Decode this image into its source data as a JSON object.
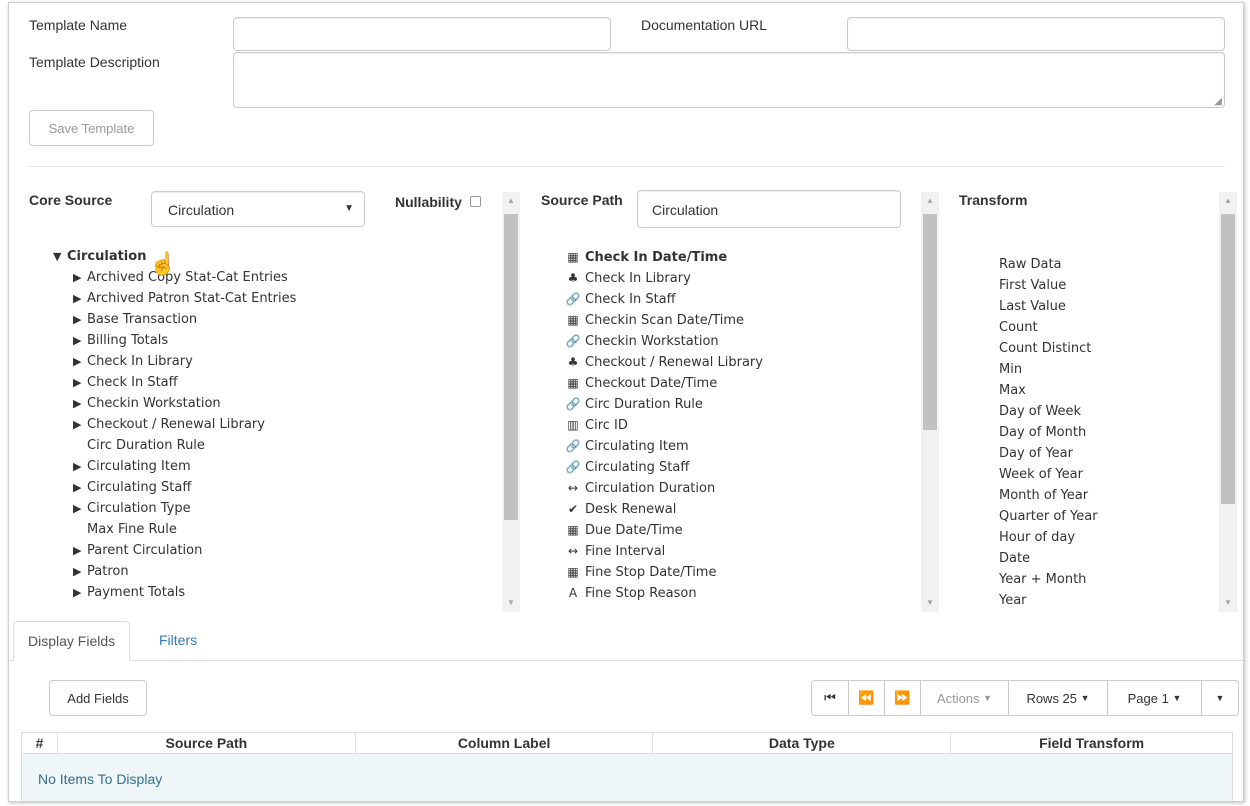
{
  "form": {
    "template_name_label": "Template Name",
    "template_name_value": "",
    "doc_url_label": "Documentation URL",
    "doc_url_value": "",
    "template_desc_label": "Template Description",
    "template_desc_value": "",
    "save_button": "Save Template"
  },
  "core_source": {
    "label": "Core Source",
    "selected": "Circulation",
    "nullability_label": "Nullability"
  },
  "tree": {
    "root": "Circulation",
    "items": [
      {
        "label": "Archived Copy Stat-Cat Entries",
        "expandable": true
      },
      {
        "label": "Archived Patron Stat-Cat Entries",
        "expandable": true
      },
      {
        "label": "Base Transaction",
        "expandable": true
      },
      {
        "label": "Billing Totals",
        "expandable": true
      },
      {
        "label": "Check In Library",
        "expandable": true
      },
      {
        "label": "Check In Staff",
        "expandable": true
      },
      {
        "label": "Checkin Workstation",
        "expandable": true
      },
      {
        "label": "Checkout / Renewal Library",
        "expandable": true
      },
      {
        "label": "Circ Duration Rule",
        "expandable": false
      },
      {
        "label": "Circulating Item",
        "expandable": true
      },
      {
        "label": "Circulating Staff",
        "expandable": true
      },
      {
        "label": "Circulation Type",
        "expandable": true
      },
      {
        "label": "Max Fine Rule",
        "expandable": false
      },
      {
        "label": "Parent Circulation",
        "expandable": true
      },
      {
        "label": "Patron",
        "expandable": true
      },
      {
        "label": "Payment Totals",
        "expandable": true
      }
    ]
  },
  "source_path": {
    "label": "Source Path",
    "value": "Circulation",
    "items": [
      {
        "icon": "calendar-icon",
        "glyph": "▦",
        "label": "Check In Date/Time",
        "bold": true
      },
      {
        "icon": "tree-icon",
        "glyph": "♣",
        "label": "Check In Library"
      },
      {
        "icon": "link-icon",
        "glyph": "🔗",
        "label": "Check In Staff"
      },
      {
        "icon": "calendar-icon",
        "glyph": "▦",
        "label": "Checkin Scan Date/Time"
      },
      {
        "icon": "link-icon",
        "glyph": "🔗",
        "label": "Checkin Workstation"
      },
      {
        "icon": "tree-icon",
        "glyph": "♣",
        "label": "Checkout / Renewal Library"
      },
      {
        "icon": "calendar-icon",
        "glyph": "▦",
        "label": "Checkout Date/Time"
      },
      {
        "icon": "link-icon",
        "glyph": "🔗",
        "label": "Circ Duration Rule"
      },
      {
        "icon": "barcode-icon",
        "glyph": "▥",
        "label": "Circ ID"
      },
      {
        "icon": "link-icon",
        "glyph": "🔗",
        "label": "Circulating Item"
      },
      {
        "icon": "link-icon",
        "glyph": "🔗",
        "label": "Circulating Staff"
      },
      {
        "icon": "arrows-horizontal-icon",
        "glyph": "↔",
        "label": "Circulation Duration"
      },
      {
        "icon": "check-circle-icon",
        "glyph": "✔",
        "label": "Desk Renewal"
      },
      {
        "icon": "calendar-icon",
        "glyph": "▦",
        "label": "Due Date/Time"
      },
      {
        "icon": "arrows-horizontal-icon",
        "glyph": "↔",
        "label": "Fine Interval"
      },
      {
        "icon": "calendar-icon",
        "glyph": "▦",
        "label": "Fine Stop Date/Time"
      },
      {
        "icon": "text-icon",
        "glyph": "A",
        "label": "Fine Stop Reason"
      }
    ]
  },
  "transform": {
    "label": "Transform",
    "items": [
      "Raw Data",
      "First Value",
      "Last Value",
      "Count",
      "Count Distinct",
      "Min",
      "Max",
      "Day of Week",
      "Day of Month",
      "Day of Year",
      "Week of Year",
      "Month of Year",
      "Quarter of Year",
      "Hour of day",
      "Date",
      "Year + Month",
      "Year"
    ]
  },
  "tabs": {
    "display_fields": "Display Fields",
    "filters": "Filters"
  },
  "toolbar": {
    "add_fields": "Add Fields",
    "actions": "Actions",
    "rows": "Rows 25",
    "page": "Page 1"
  },
  "grid": {
    "columns": [
      "#",
      "Source Path",
      "Column Label",
      "Data Type",
      "Field Transform"
    ],
    "empty_message": "No Items To Display"
  }
}
